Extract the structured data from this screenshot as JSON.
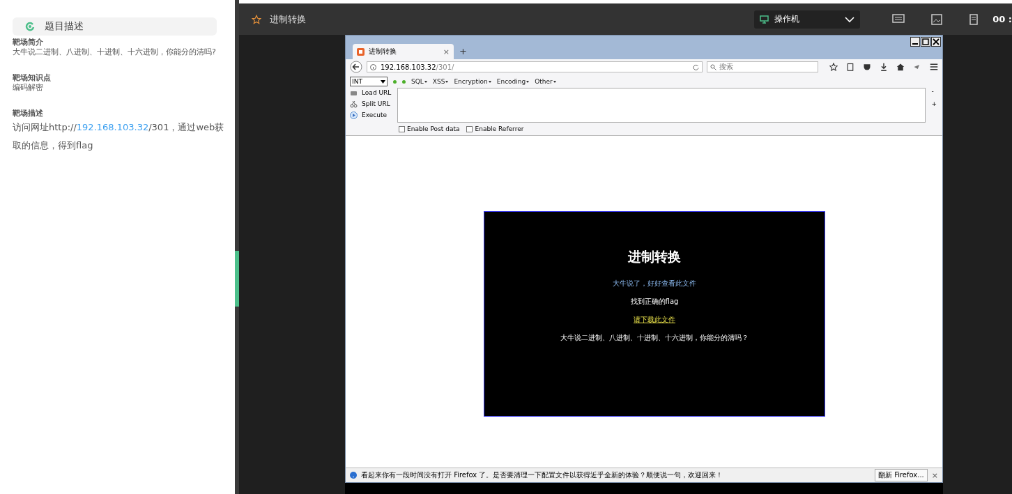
{
  "sidebar": {
    "header": "题目描述",
    "sections": [
      {
        "heading": "靶场简介",
        "parts": [
          {
            "kind": "text",
            "text": "大牛说二进制、八进制、十进制、十六进制，你能分的清吗?"
          }
        ],
        "kind": "note"
      },
      {
        "heading": "靶场知识点",
        "parts": [
          {
            "kind": "text",
            "text": "编码解密"
          }
        ],
        "kind": "note"
      },
      {
        "heading": "靶场描述",
        "parts": [
          {
            "kind": "text",
            "text": "访问网址http://"
          },
          {
            "kind": "link",
            "text": "192.168.103.32"
          },
          {
            "kind": "text",
            "text": "/301，通过web获取的信息，得到flag"
          }
        ],
        "kind": "task"
      }
    ]
  },
  "topbar": {
    "title": "进制转换",
    "machine": "操作机",
    "clock": "00 :"
  },
  "browser": {
    "tab_title": "进制转换",
    "tab_close": "×",
    "new_tab": "+",
    "url_host": "192.168.103.32",
    "url_path": "/301/",
    "search_placeholder": "搜索",
    "hackbar": {
      "select": "INT",
      "menus": [
        "SQL",
        "XSS",
        "Encryption",
        "Encoding",
        "Other"
      ],
      "actions": [
        {
          "kind": "load",
          "label": "Load URL"
        },
        {
          "kind": "split",
          "label": "Split URL"
        },
        {
          "kind": "execute",
          "label": "Execute"
        }
      ],
      "side": [
        "-",
        "+"
      ],
      "options": [
        {
          "label": "Enable Post data",
          "checked": false
        },
        {
          "label": "Enable Referrer",
          "checked": false
        }
      ]
    },
    "page": {
      "heading": "进制转换",
      "lines": [
        {
          "kind": "info",
          "text": "大牛说了，好好查看此文件"
        },
        {
          "kind": "plain",
          "text": "找到正确的flag"
        },
        {
          "kind": "link",
          "text": "请下载此文件"
        },
        {
          "kind": "plain",
          "text": "大牛说二进制、八进制、十进制、十六进制，你能分的清吗？"
        }
      ]
    },
    "notification": {
      "text": "看起来你有一段时间没有打开 Firefox 了。是否要清理一下配置文件以获得近乎全新的体验？顺便说一句，欢迎回来！",
      "button": "翻新 Firefox...",
      "close": "×"
    }
  }
}
